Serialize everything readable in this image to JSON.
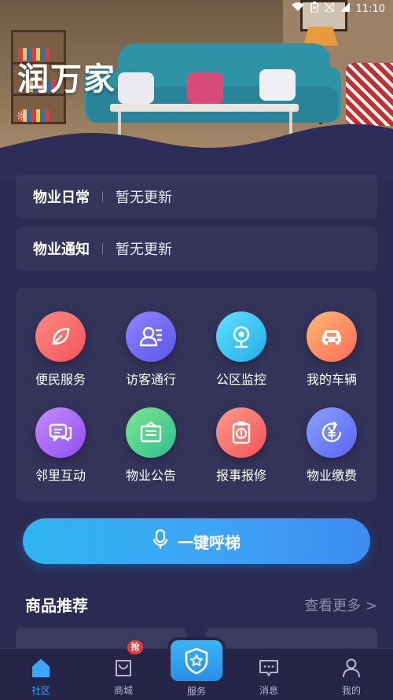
{
  "status_bar": {
    "time": "11:10"
  },
  "app": {
    "title": "润万家"
  },
  "notices": [
    {
      "label": "物业日常",
      "text": "暂无更新"
    },
    {
      "label": "物业通知",
      "text": "暂无更新"
    }
  ],
  "services": [
    {
      "name": "便民服务",
      "icon": "leaf-icon",
      "color_a": "#ff8a80",
      "color_b": "#f2545b"
    },
    {
      "name": "访客通行",
      "icon": "visitor-icon",
      "color_a": "#8f86ff",
      "color_b": "#5a56e8"
    },
    {
      "name": "公区监控",
      "icon": "webcam-icon",
      "color_a": "#5fe0ff",
      "color_b": "#23aee8"
    },
    {
      "name": "我的车辆",
      "icon": "car-icon",
      "color_a": "#ffb870",
      "color_b": "#ff6b5a"
    },
    {
      "name": "邻里互动",
      "icon": "chat-icon",
      "color_a": "#c68bff",
      "color_b": "#8f4ff0"
    },
    {
      "name": "物业公告",
      "icon": "notice-board-icon",
      "color_a": "#7ee58f",
      "color_b": "#2fbf8f"
    },
    {
      "name": "报事报修",
      "icon": "report-icon",
      "color_a": "#ff9a8a",
      "color_b": "#f2545b"
    },
    {
      "name": "物业缴费",
      "icon": "payment-icon",
      "color_a": "#8aa0ff",
      "color_b": "#5a66f0"
    }
  ],
  "elevator": {
    "label": "一键呼梯"
  },
  "recommend": {
    "title": "商品推荐",
    "more": "查看更多 >"
  },
  "tabs": [
    {
      "label": "社区",
      "icon": "home-icon",
      "active": true
    },
    {
      "label": "商城",
      "icon": "shopping-bag-icon",
      "badge": "抢"
    },
    {
      "label": "服务",
      "icon": "shield-star-icon"
    },
    {
      "label": "消息",
      "icon": "message-icon"
    },
    {
      "label": "我的",
      "icon": "user-icon"
    }
  ]
}
